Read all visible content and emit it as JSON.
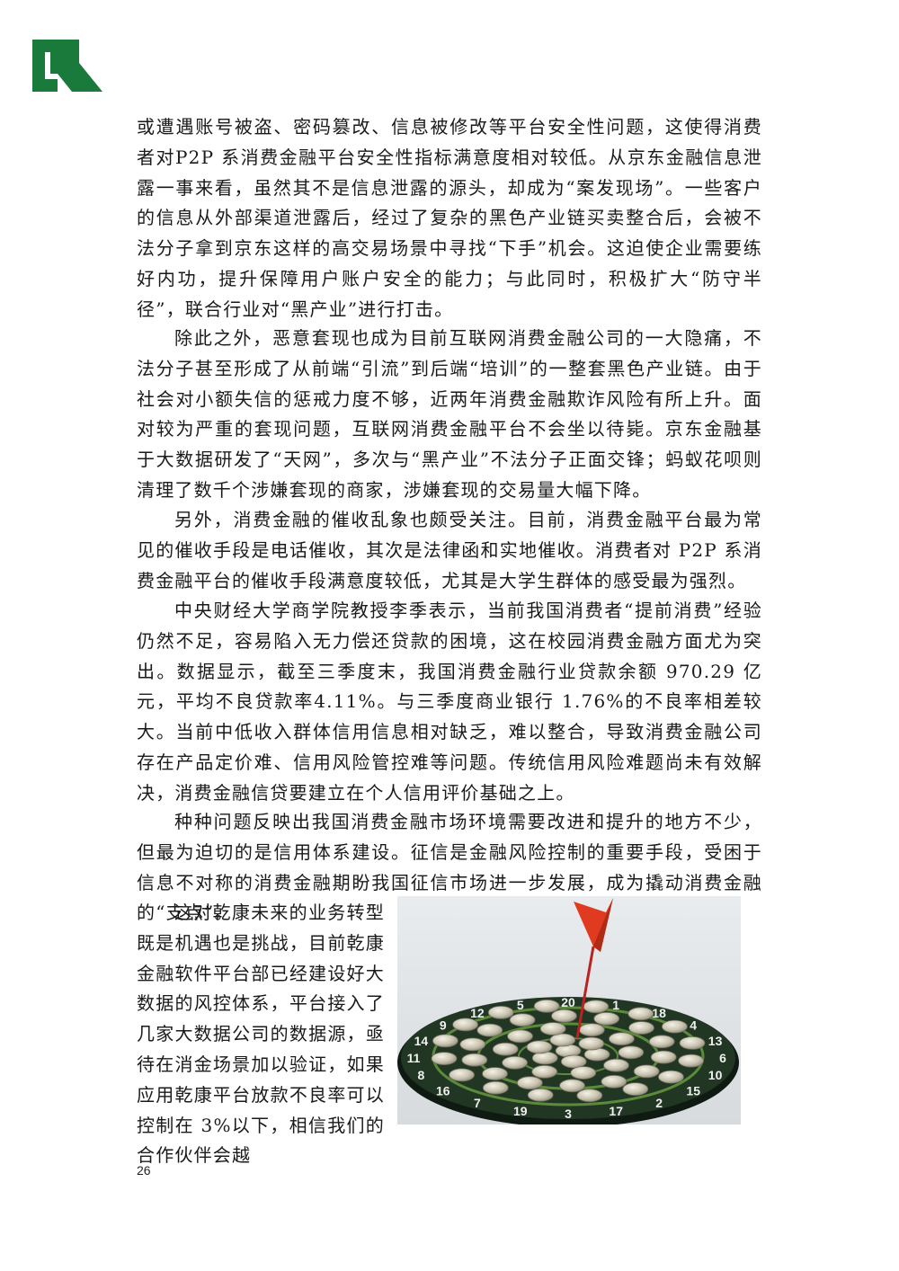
{
  "brand": {
    "logo_color": "#1a7a3c"
  },
  "paragraphs": {
    "p1": "或遭遇账号被盗、密码篡改、信息被修改等平台安全性问题，这使得消费者对P2P 系消费金融平台安全性指标满意度相对较低。从京东金融信息泄露一事来看，虽然其不是信息泄露的源头，却成为“案发现场”。一些客户的信息从外部渠道泄露后，经过了复杂的黑色产业链买卖整合后，会被不法分子拿到京东这样的高交易场景中寻找“下手”机会。这迫使企业需要练好内功，提升保障用户账户安全的能力；与此同时，积极扩大“防守半径”，联合行业对“黑产业”进行打击。",
    "p2": "除此之外，恶意套现也成为目前互联网消费金融公司的一大隐痛，不法分子甚至形成了从前端“引流”到后端“培训”的一整套黑色产业链。由于社会对小额失信的惩戒力度不够，近两年消费金融欺诈风险有所上升。面对较为严重的套现问题，互联网消费金融平台不会坐以待毙。京东金融基于大数据研发了“天网”，多次与“黑产业”不法分子正面交锋；蚂蚁花呗则清理了数千个涉嫌套现的商家，涉嫌套现的交易量大幅下降。",
    "p3": "另外，消费金融的催收乱象也颇受关注。目前，消费金融平台最为常见的催收手段是电话催收，其次是法律函和实地催收。消费者对 P2P 系消费金融平台的催收手段满意度较低，尤其是大学生群体的感受最为强烈。",
    "p4": "中央财经大学商学院教授李季表示，当前我国消费者“提前消费”经验仍然不足，容易陷入无力偿还贷款的困境，这在校园消费金融方面尤为突出。数据显示，截至三季度末，我国消费金融行业贷款余额 970.29 亿元，平均不良贷款率4.11%。与三季度商业银行 1.76%的不良率相差较大。当前中低收入群体信用信息相对缺乏，难以整合，导致消费金融公司存在产品定价难、信用风险管控难等问题。传统信用风险难题尚未有效解决，消费金融信贷要建立在个人信用评价基础之上。",
    "p5": "种种问题反映出我国消费金融市场环境需要改进和提升的地方不少，但最为迫切的是信用体系建设。征信是金融风险控制的重要手段，受困于信息不对称的消费金融期盼我国征信市场进一步发展，成为撬动消费金融的“支点”。",
    "p6": "这对乾康未来的业务转型既是机遇也是挑战，目前乾康金融软件平台部已经建设好大数据的风控体系，平台接入了几家大数据公司的数据源，亟待在消金场景加以验证，如果应用乾康平台放款不良率可以控制在 3%以下，相信我们的合作伙伴会越"
  },
  "figure": {
    "board_numbers": [
      "20",
      "1",
      "18",
      "4",
      "13",
      "6",
      "10",
      "15",
      "2",
      "17",
      "3",
      "19",
      "7",
      "16",
      "8",
      "11",
      "14",
      "9",
      "12",
      "5"
    ]
  },
  "page_number": "26"
}
